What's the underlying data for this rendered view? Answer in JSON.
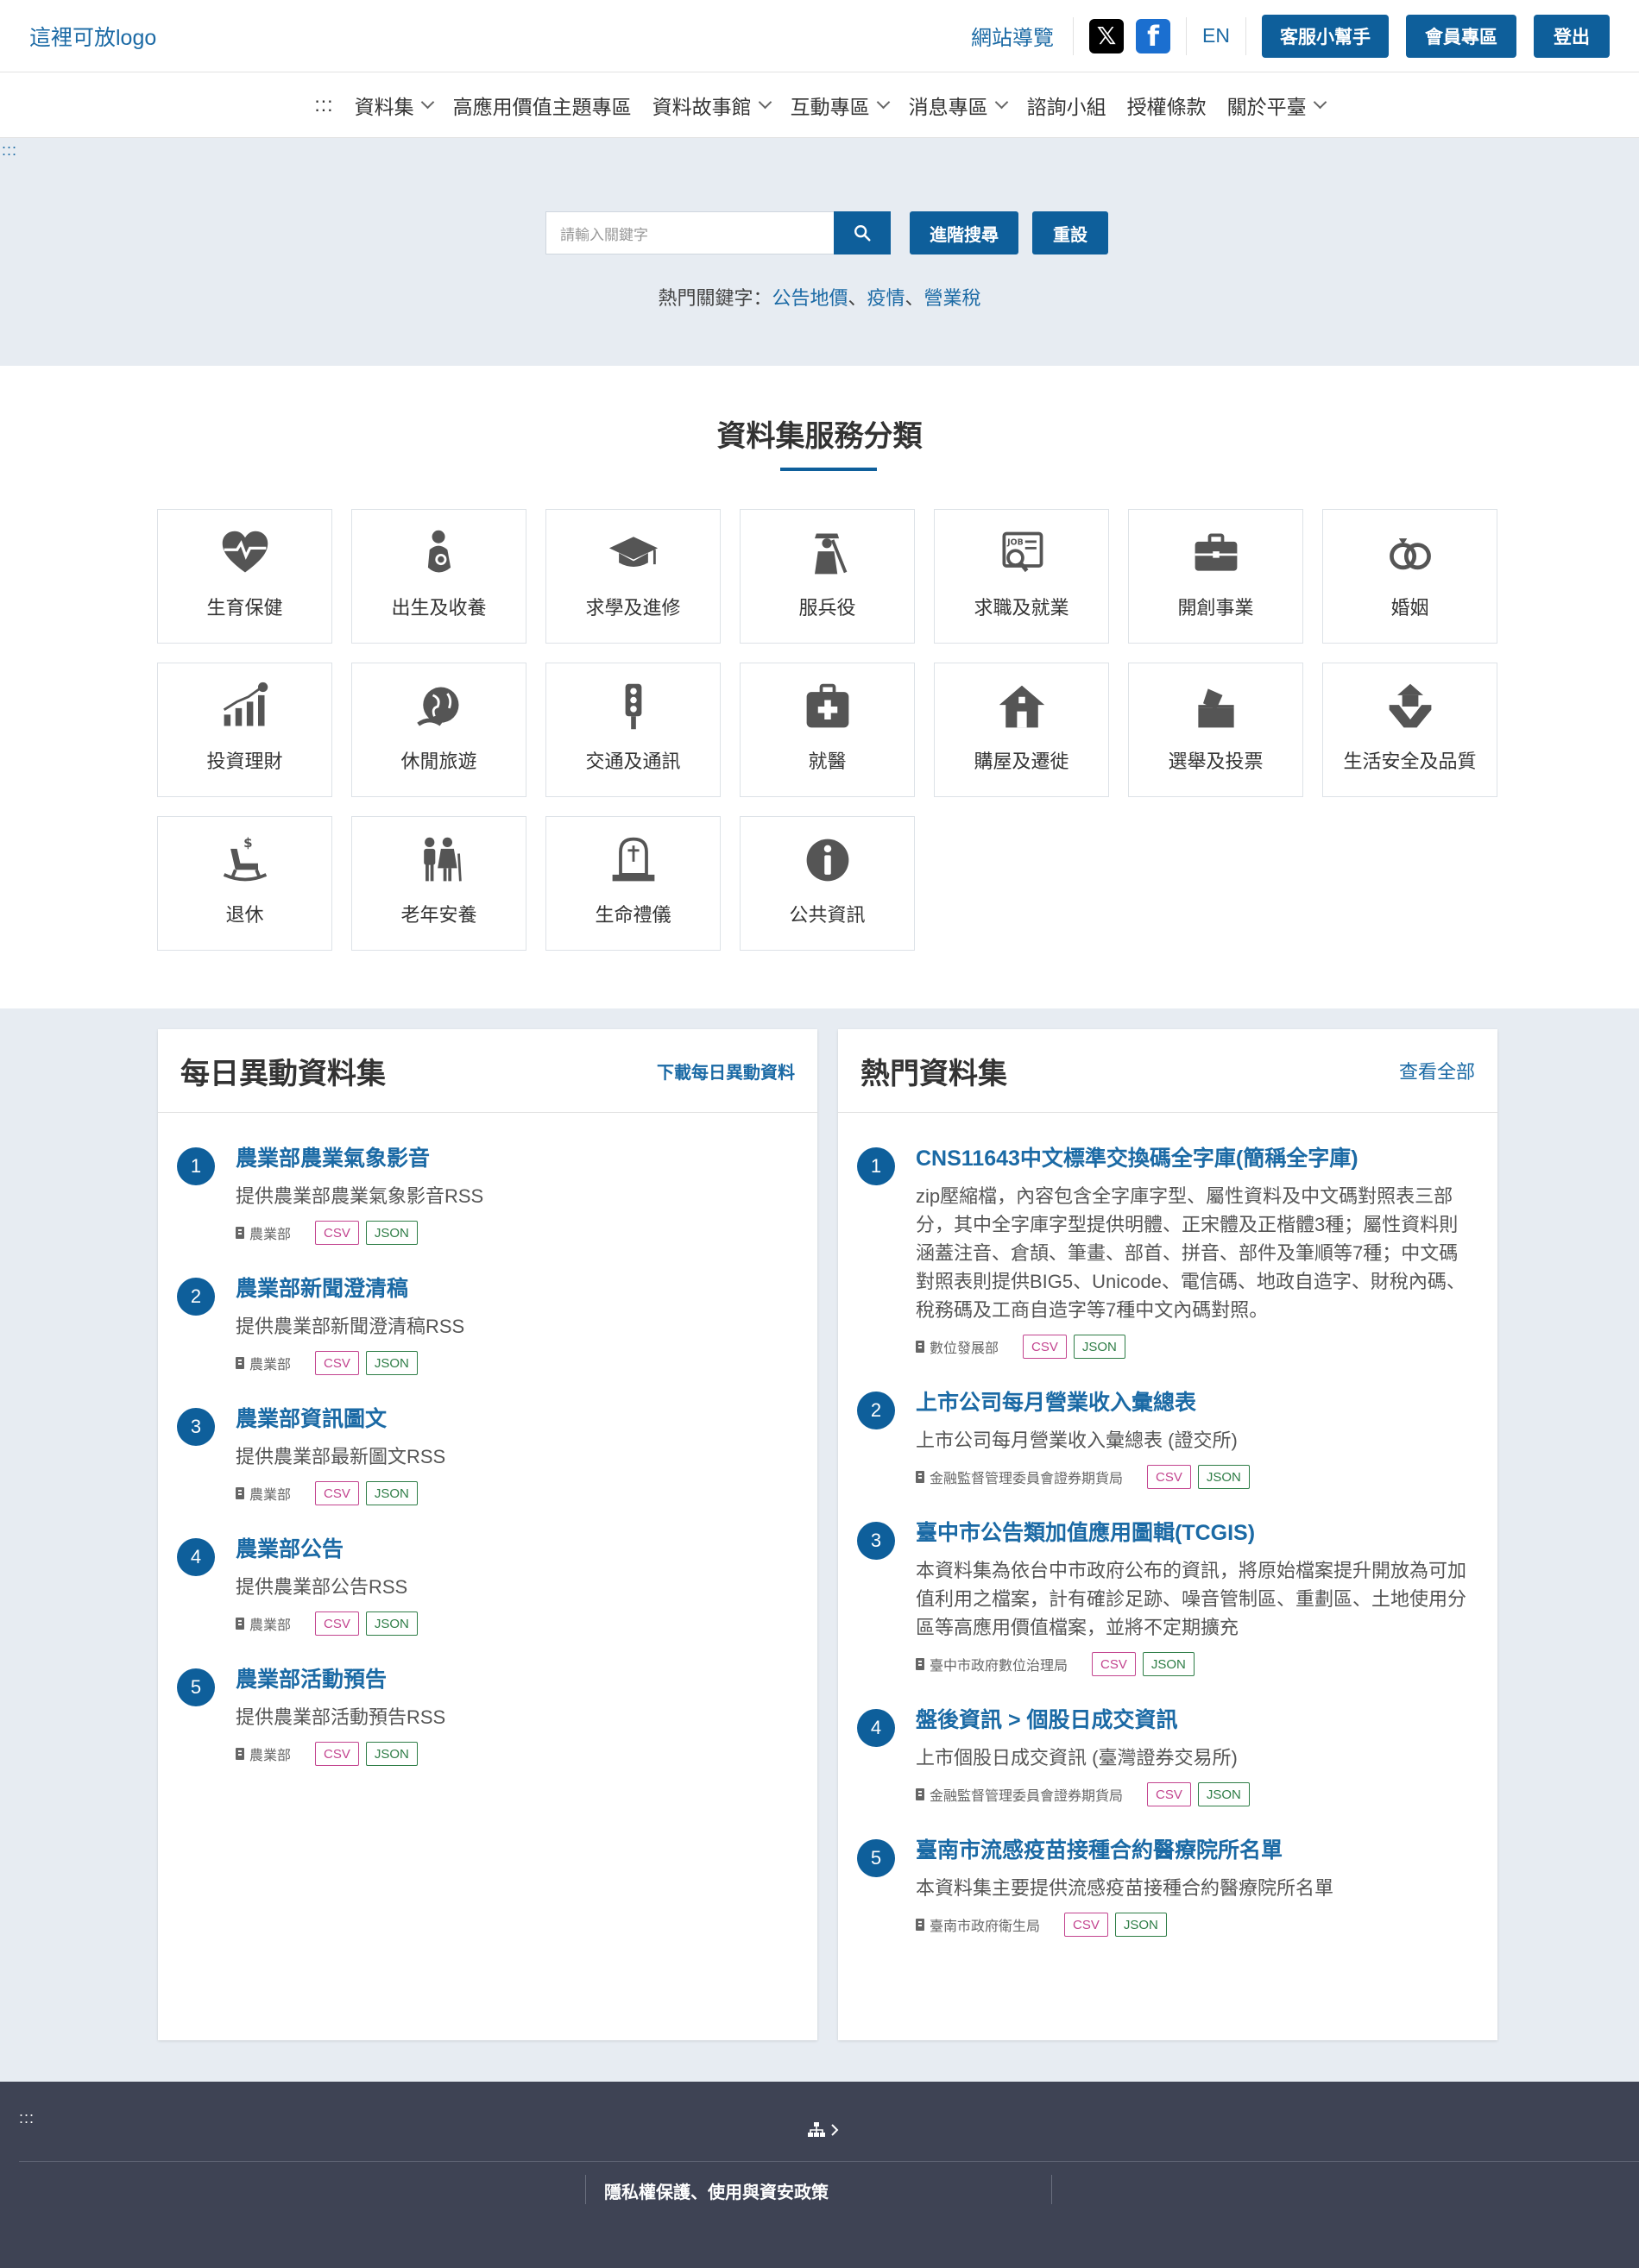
{
  "header": {
    "logo": "這裡可放logo",
    "sitemap": "網站導覽",
    "social": {
      "x_icon": "x-logo-icon",
      "fb_icon": "facebook-icon"
    },
    "lang": "EN",
    "buttons": {
      "service": "客服小幫手",
      "member": "會員專區",
      "logout": "登出"
    },
    "accesskey": ":::"
  },
  "nav": {
    "items": [
      {
        "label": "資料集",
        "dropdown": true
      },
      {
        "label": "高應用價值主題專區",
        "dropdown": false
      },
      {
        "label": "資料故事館",
        "dropdown": true
      },
      {
        "label": "互動專區",
        "dropdown": true
      },
      {
        "label": "消息專區",
        "dropdown": true
      },
      {
        "label": "諮詢小組",
        "dropdown": false
      },
      {
        "label": "授權條款",
        "dropdown": false
      },
      {
        "label": "關於平臺",
        "dropdown": true
      }
    ]
  },
  "search": {
    "placeholder": "請輸入關鍵字",
    "advanced": "進階搜尋",
    "reset": "重設",
    "hot_label": "熱門關鍵字：",
    "hot": [
      "公告地價",
      "疫情",
      "營業稅"
    ],
    "sep": "、"
  },
  "categories": {
    "title": "資料集服務分類",
    "items": [
      {
        "label": "生育保健",
        "icon": "heart-pulse-icon"
      },
      {
        "label": "出生及收養",
        "icon": "baby-icon"
      },
      {
        "label": "求學及進修",
        "icon": "graduation-cap-icon"
      },
      {
        "label": "服兵役",
        "icon": "soldier-icon"
      },
      {
        "label": "求職及就業",
        "icon": "job-board-icon"
      },
      {
        "label": "開創事業",
        "icon": "briefcase-icon"
      },
      {
        "label": "婚姻",
        "icon": "rings-icon"
      },
      {
        "label": "投資理財",
        "icon": "investment-chart-icon"
      },
      {
        "label": "休閒旅遊",
        "icon": "globe-travel-icon"
      },
      {
        "label": "交通及通訊",
        "icon": "traffic-light-icon"
      },
      {
        "label": "就醫",
        "icon": "medical-kit-icon"
      },
      {
        "label": "購屋及遷徙",
        "icon": "house-icon"
      },
      {
        "label": "選舉及投票",
        "icon": "ballot-box-icon"
      },
      {
        "label": "生活安全及品質",
        "icon": "hand-house-icon"
      },
      {
        "label": "退休",
        "icon": "rocking-chair-icon"
      },
      {
        "label": "老年安養",
        "icon": "elderly-couple-icon"
      },
      {
        "label": "生命禮儀",
        "icon": "tombstone-icon"
      },
      {
        "label": "公共資訊",
        "icon": "info-icon"
      }
    ]
  },
  "daily": {
    "title": "每日異動資料集",
    "link": "下載每日異動資料",
    "items": [
      {
        "num": "1",
        "title": "農業部農業氣象影音",
        "desc": "提供農業部農業氣象影音RSS",
        "org": "農業部",
        "csv": "CSV",
        "json": "JSON"
      },
      {
        "num": "2",
        "title": "農業部新聞澄清稿",
        "desc": "提供農業部新聞澄清稿RSS",
        "org": "農業部",
        "csv": "CSV",
        "json": "JSON"
      },
      {
        "num": "3",
        "title": "農業部資訊圖文",
        "desc": "提供農業部最新圖文RSS",
        "org": "農業部",
        "csv": "CSV",
        "json": "JSON"
      },
      {
        "num": "4",
        "title": "農業部公告",
        "desc": "提供農業部公告RSS",
        "org": "農業部",
        "csv": "CSV",
        "json": "JSON"
      },
      {
        "num": "5",
        "title": "農業部活動預告",
        "desc": "提供農業部活動預告RSS",
        "org": "農業部",
        "csv": "CSV",
        "json": "JSON"
      }
    ]
  },
  "popular": {
    "title": "熱門資料集",
    "link": "查看全部",
    "items": [
      {
        "num": "1",
        "title": "CNS11643中文標準交換碼全字庫(簡稱全字庫)",
        "desc": "zip壓縮檔，內容包含全字庫字型、屬性資料及中文碼對照表三部分，其中全字庫字型提供明體、正宋體及正楷體3種；屬性資料則涵蓋注音、倉頡、筆畫、部首、拼音、部件及筆順等7種；中文碼對照表則提供BIG5、Unicode、電信碼、地政自造字、財稅內碼、稅務碼及工商自造字等7種中文內碼對照。",
        "org": "數位發展部",
        "csv": "CSV",
        "json": "JSON"
      },
      {
        "num": "2",
        "title": "上市公司每月營業收入彙總表",
        "desc": "上市公司每月營業收入彙總表 (證交所)",
        "org": "金融監督管理委員會證券期貨局",
        "csv": "CSV",
        "json": "JSON"
      },
      {
        "num": "3",
        "title": "臺中市公告類加值應用圖輯(TCGIS)",
        "desc": "本資料集為依台中市政府公布的資訊，將原始檔案提升開放為可加值利用之檔案，計有確診足跡、噪音管制區、重劃區、土地使用分區等高應用價值檔案，並將不定期擴充",
        "org": "臺中市政府數位治理局",
        "csv": "CSV",
        "json": "JSON"
      },
      {
        "num": "4",
        "title": "盤後資訊 > 個股日成交資訊",
        "desc": "上市個股日成交資訊 (臺灣證券交易所)",
        "org": "金融監督管理委員會證券期貨局",
        "csv": "CSV",
        "json": "JSON"
      },
      {
        "num": "5",
        "title": "臺南市流感疫苗接種合約醫療院所名單",
        "desc": "本資料集主要提供流感疫苗接種合約醫療院所名單",
        "org": "臺南市政府衛生局",
        "csv": "CSV",
        "json": "JSON"
      }
    ]
  },
  "footer": {
    "accesskey": ":::",
    "sitemap_icon": "sitemap-icon",
    "privacy": "隱私權保護、使用與資安政策"
  },
  "colors": {
    "primary": "#0e5f9b",
    "link": "#1b6aa5",
    "band": "#e7ecf2",
    "footer": "#3e4354",
    "csv": "#c3448f",
    "json": "#2e7d46"
  }
}
